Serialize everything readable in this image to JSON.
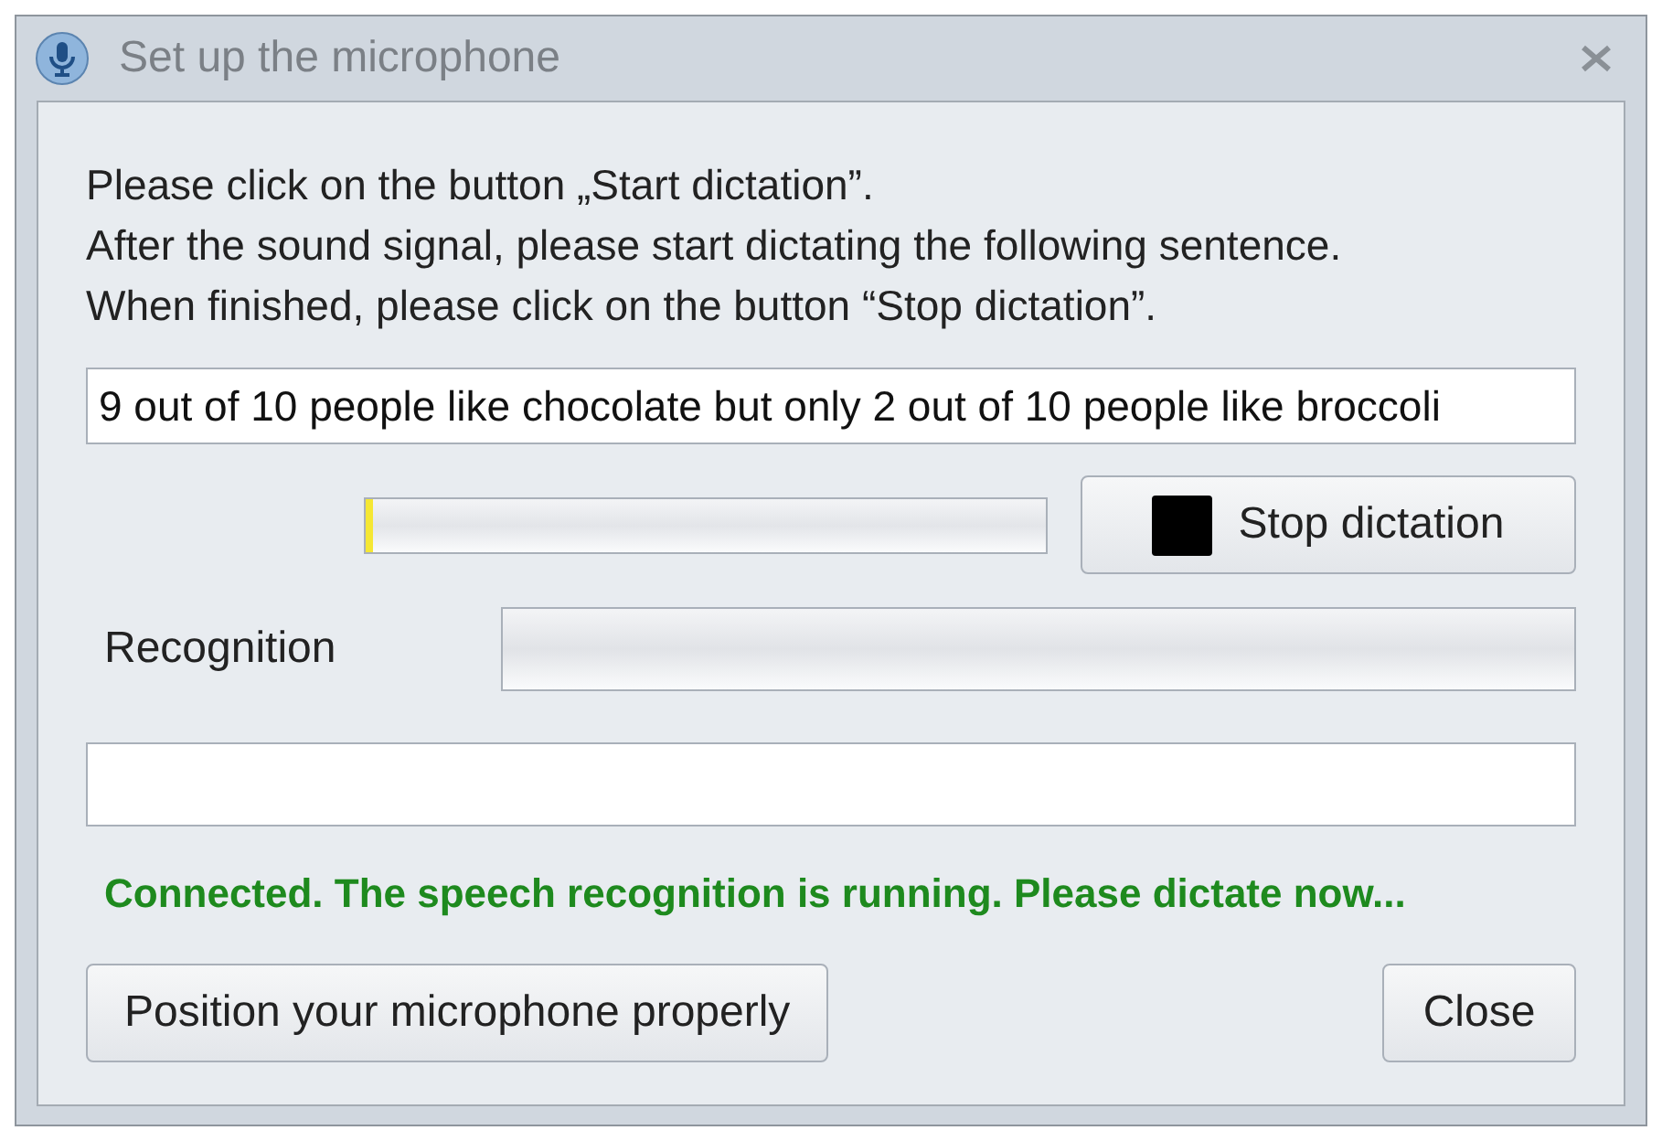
{
  "window": {
    "title": "Set up the microphone"
  },
  "instructions": [
    "Please click on the button „Start dictation”.",
    "After the sound signal, please start dictating the following sentence.",
    "When finished, please click on the button “Stop dictation”."
  ],
  "sentence": {
    "value": "9 out of 10 people like chocolate but only 2 out of 10 people like broccoli"
  },
  "volume_meter": {
    "level": 0.01
  },
  "stop_button": {
    "label": "Stop dictation"
  },
  "recognition": {
    "label": "Recognition"
  },
  "status": "Connected. The speech recognition is running. Please dictate now...",
  "buttons": [
    {
      "kind": "position",
      "label": "Position your microphone properly"
    },
    {
      "kind": "close",
      "label": "Close"
    }
  ]
}
